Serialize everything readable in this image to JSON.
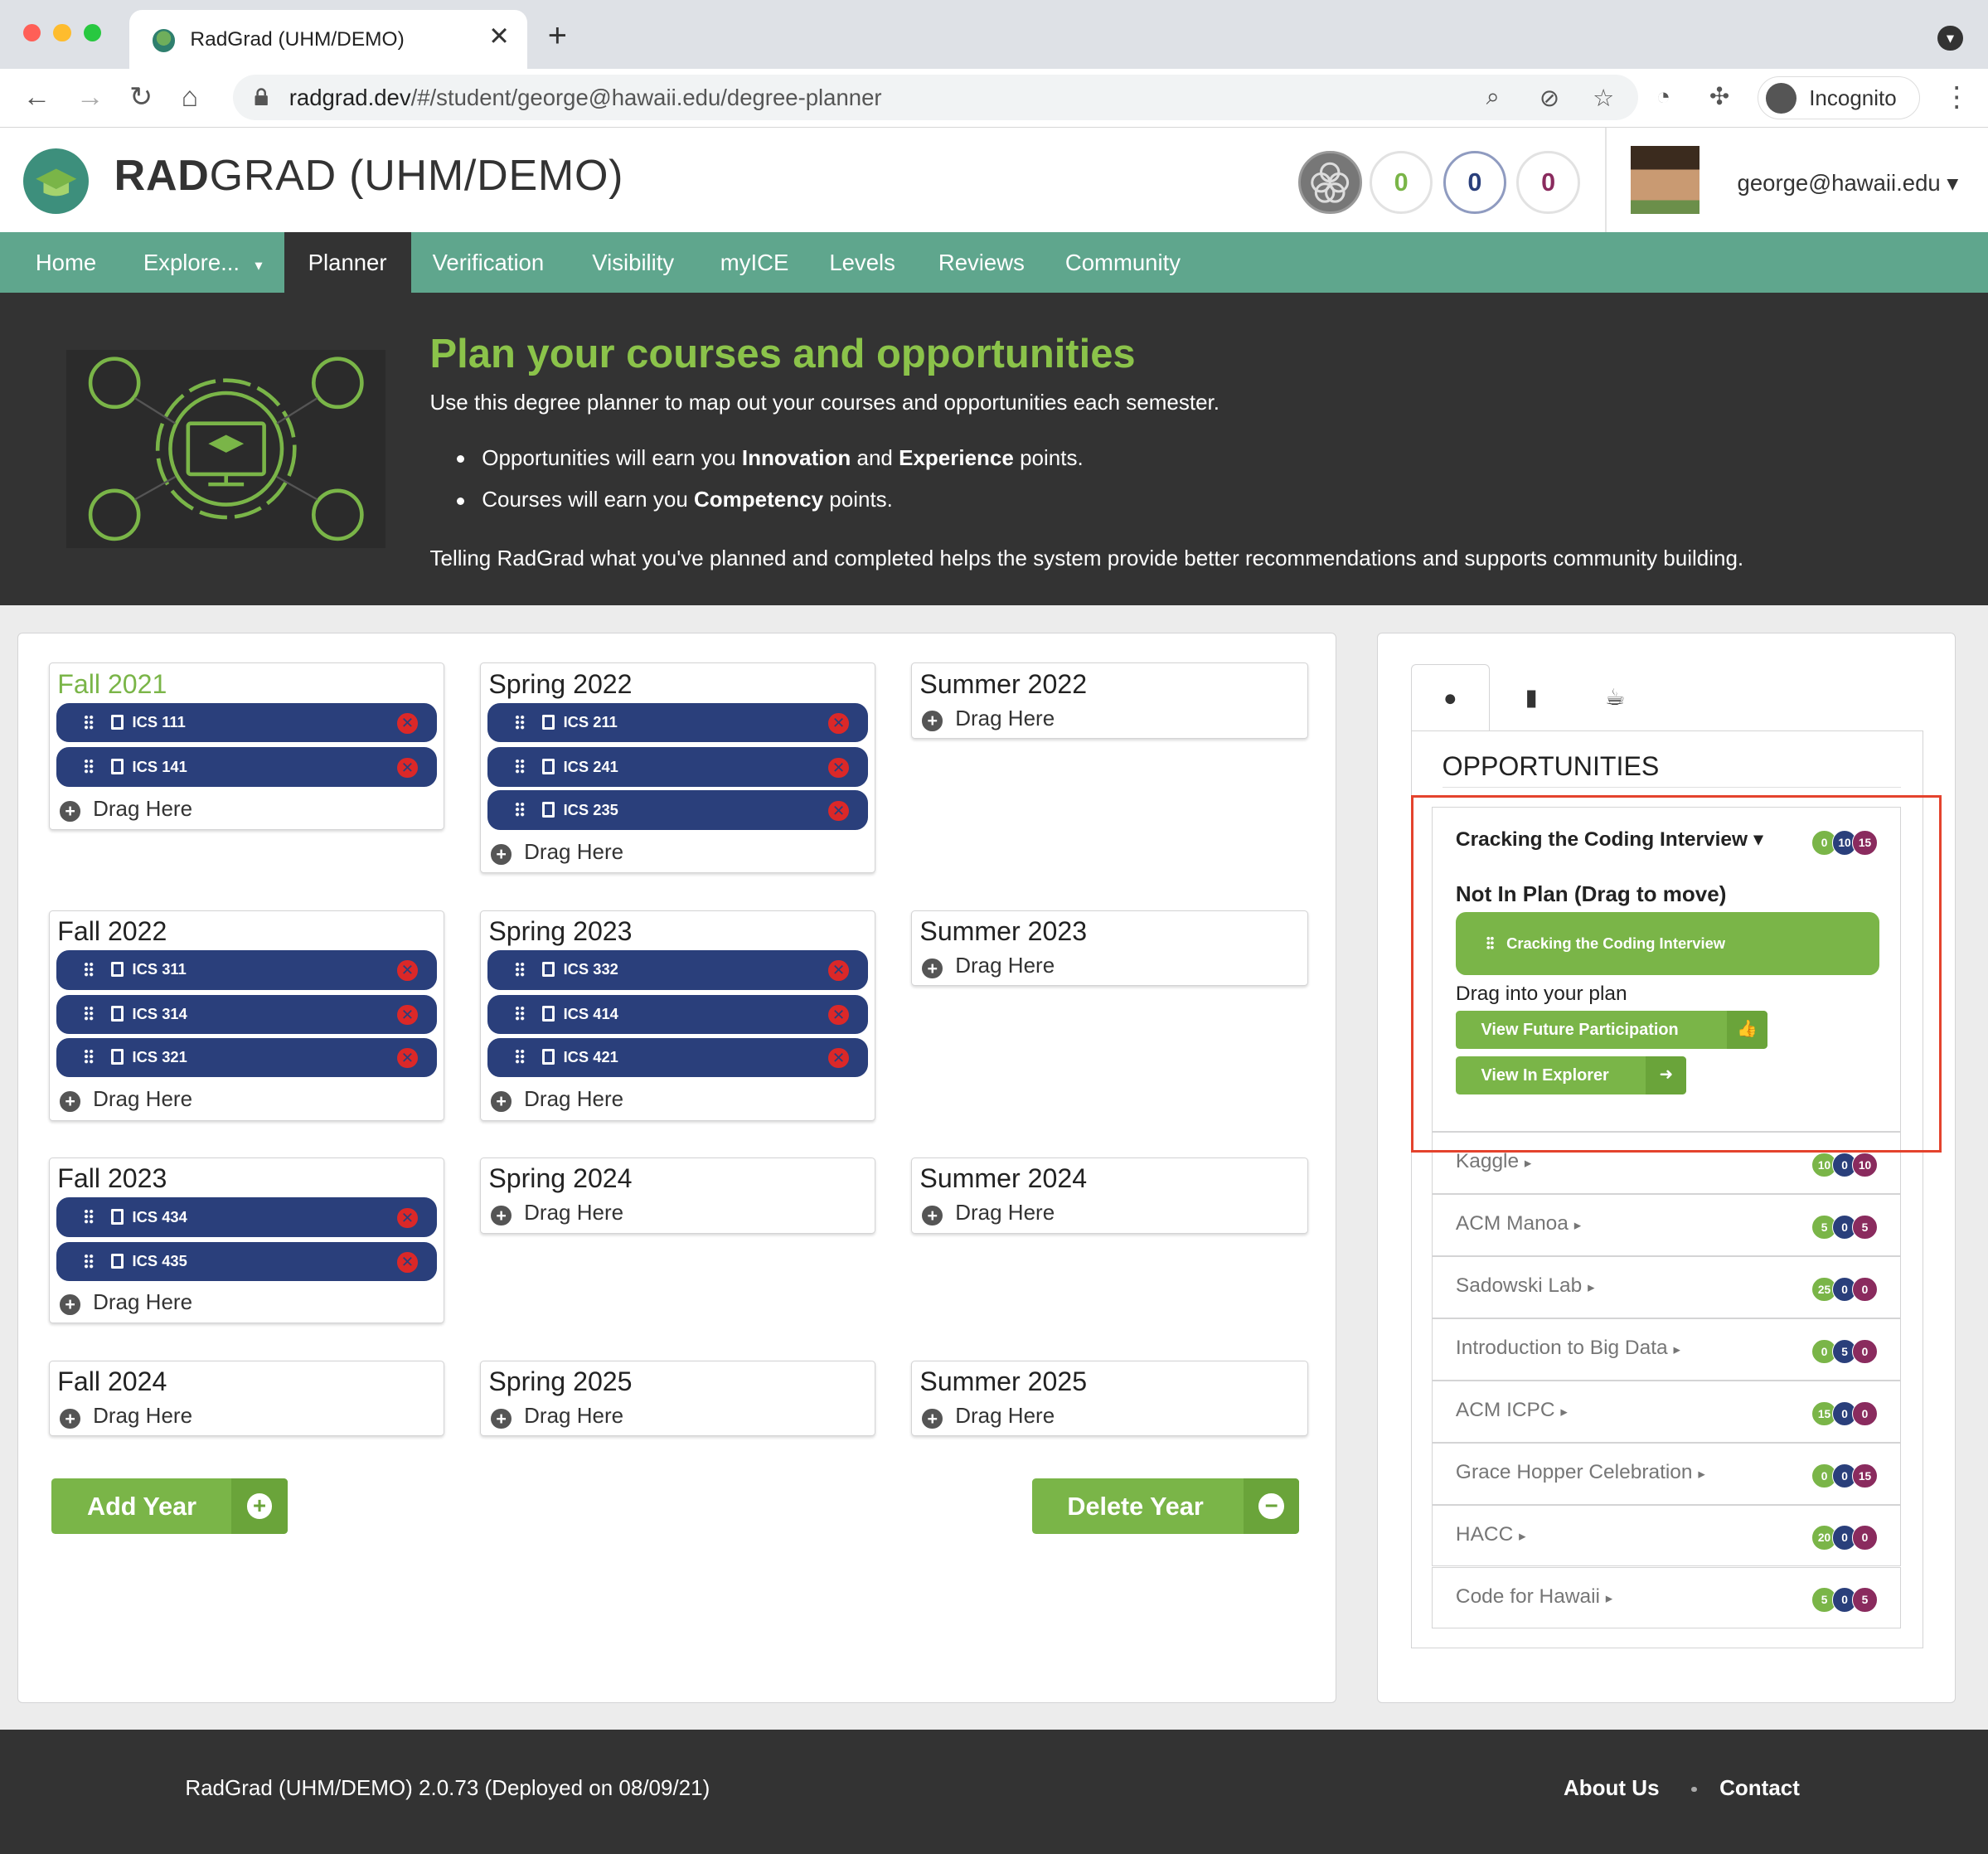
{
  "browser": {
    "tab_title": "RadGrad (UHM/DEMO)",
    "url_domain": "radgrad.dev",
    "url_path": "/#/student/george@hawaii.edu/degree-planner",
    "incognito_label": "Incognito",
    "colors": {
      "red": "#ff5f57",
      "yellow": "#febc2e",
      "green": "#28c840"
    }
  },
  "header": {
    "brand_bold": "RAD",
    "brand_rest": "GRAD (UHM/DEMO)",
    "ice": {
      "innovation": "0",
      "competency": "0",
      "experience": "0"
    },
    "user_email": "george@hawaii.edu"
  },
  "menu": {
    "items": [
      "Home",
      "Explore...",
      "Planner",
      "Verification",
      "Visibility",
      "myICE",
      "Levels",
      "Reviews",
      "Community"
    ],
    "active": "Planner"
  },
  "hero": {
    "title": "Plan your courses and opportunities",
    "intro": "Use this degree planner to map out your courses and opportunities each semester.",
    "bullet1_a": "Opportunities will earn you ",
    "bullet1_b": "Innovation",
    "bullet1_c": " and ",
    "bullet1_d": "Experience",
    "bullet1_e": " points.",
    "bullet2_a": "Courses will earn you ",
    "bullet2_b": "Competency",
    "bullet2_c": " points.",
    "closing": "Telling RadGrad what you've planned and completed helps the system provide better recommendations and supports community building."
  },
  "planner": {
    "drag_here": "Drag Here",
    "semesters": [
      {
        "title": "Fall 2021",
        "courses": [
          "ICS 111",
          "ICS 141"
        ]
      },
      {
        "title": "Spring 2022",
        "courses": [
          "ICS 211",
          "ICS 241",
          "ICS 235"
        ]
      },
      {
        "title": "Summer 2022",
        "courses": []
      },
      {
        "title": "Fall 2022",
        "courses": [
          "ICS 311",
          "ICS 314",
          "ICS 321"
        ]
      },
      {
        "title": "Spring 2023",
        "courses": [
          "ICS 332",
          "ICS 414",
          "ICS 421"
        ]
      },
      {
        "title": "Summer 2023",
        "courses": []
      },
      {
        "title": "Fall 2023",
        "courses": [
          "ICS 434",
          "ICS 435"
        ]
      },
      {
        "title": "Spring 2024",
        "courses": []
      },
      {
        "title": "Summer 2024",
        "courses": []
      },
      {
        "title": "Fall 2024",
        "courses": []
      },
      {
        "title": "Spring 2025",
        "courses": []
      },
      {
        "title": "Summer 2025",
        "courses": []
      }
    ],
    "add_year": "Add Year",
    "delete_year": "Delete Year"
  },
  "sidebar": {
    "tabs": [
      "lightbulb-icon",
      "book-icon",
      "coffee-icon"
    ],
    "heading": "OPPORTUNITIES",
    "expanded": {
      "name": "Cracking the Coding Interview",
      "points": [
        "0",
        "10",
        "15"
      ],
      "status": "Not In Plan (Drag to move)",
      "chip": "Cracking the Coding Interview",
      "drag_into": "Drag into your plan",
      "view_future": "View Future Participation",
      "view_explorer": "View In Explorer"
    },
    "opportunities": [
      {
        "name": "Kaggle",
        "points": [
          "10",
          "0",
          "10"
        ]
      },
      {
        "name": "ACM Manoa",
        "points": [
          "5",
          "0",
          "5"
        ]
      },
      {
        "name": "Sadowski Lab",
        "points": [
          "25",
          "0",
          "0"
        ]
      },
      {
        "name": "Introduction to Big Data",
        "points": [
          "0",
          "5",
          "0"
        ]
      },
      {
        "name": "ACM ICPC",
        "points": [
          "15",
          "0",
          "0"
        ]
      },
      {
        "name": "Grace Hopper Celebration",
        "points": [
          "0",
          "0",
          "15"
        ]
      },
      {
        "name": "HACC",
        "points": [
          "20",
          "0",
          "0"
        ]
      },
      {
        "name": "Code for Hawaii",
        "points": [
          "5",
          "0",
          "5"
        ]
      }
    ]
  },
  "footer": {
    "version": "RadGrad (UHM/DEMO) 2.0.73 (Deployed on 08/09/21)",
    "about": "About Us",
    "contact": "Contact"
  },
  "colors": {
    "green": "#7ab548",
    "teal": "#5fa68d",
    "navy": "#2a3f7b",
    "maroon": "#8a2b5e",
    "dark": "#333333",
    "highlight": "#e4432d"
  }
}
